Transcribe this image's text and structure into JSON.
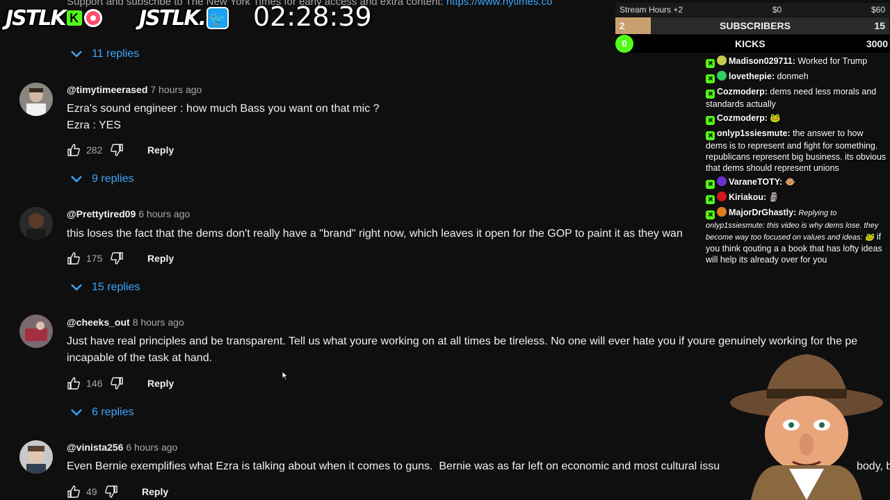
{
  "top_line": {
    "text": "Support and subscribe to The New York Times for early access and extra content: ",
    "link": "https://www.nytimes.co"
  },
  "overlay": {
    "logo1": "JSTLK",
    "logo1_badge": "K",
    "logo2": "JSTLK.",
    "timer": "02:28:39",
    "stream_hours": "Stream Hours +2",
    "goal_current": "$0",
    "goal_total": "$60",
    "subs_count": "2",
    "subs_label": "SUBSCRIBERS",
    "subs_goal": "15",
    "subs_progress": 0.13,
    "kicks_count": "0",
    "kicks_label": "KICKS",
    "kicks_goal": "3000"
  },
  "comments": [
    {
      "handle": "@timytimeerased",
      "time": "7 hours ago",
      "text": "Ezra's sound engineer : how much Bass you want on that mic ?\nEzra : YES",
      "likes": "282",
      "reply_label": "Reply",
      "replies": "9 replies"
    },
    {
      "handle": "@Prettytired09",
      "time": "6 hours ago",
      "text": "this loses the fact that the dems don't really have a \"brand\" right now, which leaves it open for the GOP to paint it as they wan",
      "likes": "175",
      "reply_label": "Reply",
      "replies": "15 replies"
    },
    {
      "handle": "@cheeks_out",
      "time": "8 hours ago",
      "text": "Just have real principles and be transparent. Tell us what youre working on at all times be tireless. No one will ever hate you if youre genuinely working for the pe\nincapable of the task at hand.",
      "likes": "146",
      "reply_label": "Reply",
      "replies": "6 replies"
    },
    {
      "handle": "@vinista256",
      "time": "6 hours ago",
      "text": "Even Bernie exemplifies what Ezra is talking about when it comes to guns.  Bernie was as far left on economic and most cultural issu",
      "text_end": "body, b",
      "likes": "49",
      "reply_label": "Reply"
    }
  ],
  "first_replies": "11 replies",
  "chat": [
    {
      "name": "Madison029711:",
      "msg": " Worked for Trump",
      "badge": "#c8c850"
    },
    {
      "name": "lovethepie:",
      "msg": " donmeh",
      "badge": "#33cc66"
    },
    {
      "name": "Cozmoderp:",
      "msg": " dems need less morals and standards actually",
      "badge": ""
    },
    {
      "name": "Cozmoderp:",
      "msg": " 🐸",
      "badge": ""
    },
    {
      "name": "onlyp1ssiesmute:",
      "msg": " the answer to how dems is to represent and fight for something. republicans represent big business. its obvious that dems should represent unions",
      "badge": ""
    },
    {
      "name": "VaraneTOTY:",
      "msg": " 🐵",
      "badge": "#6a2fd0"
    },
    {
      "name": "Kiriakou:",
      "msg": " 🗿",
      "badge": "#cc1a1a"
    },
    {
      "name": "MajorDrGhastly:",
      "reply_ctx": " Replying to onlyp1ssiesmute: this video is why dems lose. they become way too focused on values and ideas: 🐸",
      "msg": " if you think qouting a a book that has lofty ideas will help its already over for you",
      "badge": "#e07a20"
    }
  ]
}
